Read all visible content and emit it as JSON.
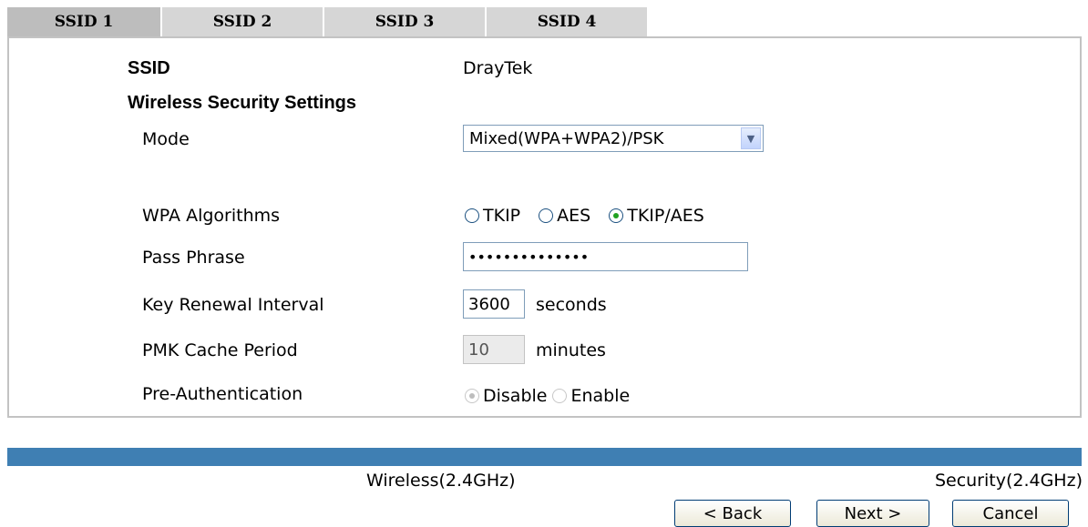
{
  "tabs": [
    {
      "label": "SSID 1",
      "active": true
    },
    {
      "label": "SSID 2",
      "active": false
    },
    {
      "label": "SSID 3",
      "active": false
    },
    {
      "label": "SSID 4",
      "active": false
    }
  ],
  "form": {
    "ssid_label": "SSID",
    "ssid_value": "DrayTek",
    "section_title": "Wireless Security Settings",
    "mode_label": "Mode",
    "mode_value": "Mixed(WPA+WPA2)/PSK",
    "wpa_label": "WPA Algorithms",
    "wpa_options": [
      "TKIP",
      "AES",
      "TKIP/AES"
    ],
    "wpa_selected": "TKIP/AES",
    "pass_label": "Pass Phrase",
    "pass_value": "••••••••••••••",
    "key_label": "Key Renewal Interval",
    "key_value": "3600",
    "key_unit": "seconds",
    "pmk_label": "PMK Cache Period",
    "pmk_value": "10",
    "pmk_unit": "minutes",
    "preauth_label": "Pre-Authentication",
    "preauth_options": [
      "Disable",
      "Enable"
    ],
    "preauth_selected": "Disable"
  },
  "footer": {
    "step_left": "Wireless(2.4GHz)",
    "step_right": "Security(2.4GHz)",
    "back": "< Back",
    "next": "Next >",
    "cancel": "Cancel"
  },
  "colors": {
    "bar": "#3f7fb3",
    "radio_checked": "#21a121"
  }
}
